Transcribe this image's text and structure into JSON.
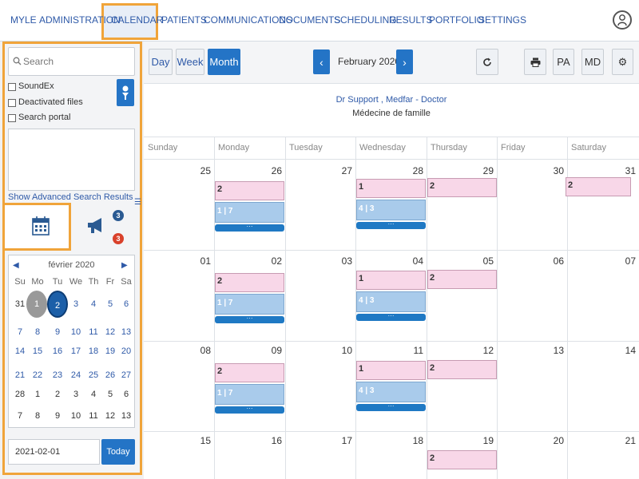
{
  "nav": {
    "items": [
      "MYLE",
      "ADMINISTRATION",
      "CALENDAR",
      "PATIENTS",
      "COMMUNICATIONS",
      "DOCUMENTS",
      "SCHEDULING",
      "RESULTS",
      "PORTFOLIO",
      "SETTINGS"
    ],
    "active": "CALENDAR"
  },
  "sidebar": {
    "search_placeholder": "Search",
    "options": [
      "SoundEx",
      "Deactivated files",
      "Search portal"
    ],
    "show_advanced": "Show Advanced Search Results",
    "badges": {
      "messages": "3",
      "alerts": "3"
    },
    "minical": {
      "title": "février 2020",
      "weekdays": [
        "Su",
        "Mo",
        "Tu",
        "We",
        "Th",
        "Fr",
        "Sa"
      ],
      "weeks": [
        [
          "31",
          "1",
          "2",
          "3",
          "4",
          "5",
          "6"
        ],
        [
          "7",
          "8",
          "9",
          "10",
          "11",
          "12",
          "13"
        ],
        [
          "14",
          "15",
          "16",
          "17",
          "18",
          "19",
          "20"
        ],
        [
          "21",
          "22",
          "23",
          "24",
          "25",
          "26",
          "27"
        ],
        [
          "28",
          "1",
          "2",
          "3",
          "4",
          "5",
          "6"
        ],
        [
          "7",
          "8",
          "9",
          "10",
          "11",
          "12",
          "13"
        ]
      ],
      "selected": "2",
      "highlighted": "1"
    },
    "date_value": "2021-02-01",
    "today_label": "Today"
  },
  "toolbar": {
    "views": [
      "Day",
      "Week",
      "Month"
    ],
    "active_view": "Month",
    "month_label": "February 2020",
    "pa_label": "PA",
    "md_label": "MD"
  },
  "provider": {
    "name": "Dr Support , Medfar - Doctor",
    "specialty": "Médecine de famille"
  },
  "calendar": {
    "weekdays": [
      "Sunday",
      "Monday",
      "Tuesday",
      "Wednesday",
      "Thursday",
      "Friday",
      "Saturday"
    ],
    "weeks": [
      [
        "25",
        "26",
        "27",
        "28",
        "29",
        "30",
        "31"
      ],
      [
        "01",
        "02",
        "03",
        "04",
        "05",
        "06",
        "07"
      ],
      [
        "08",
        "09",
        "10",
        "11",
        "12",
        "13",
        "14"
      ],
      [
        "15",
        "16",
        "17",
        "18",
        "19",
        "20",
        "21"
      ]
    ],
    "events": {
      "monday_pink": "2",
      "monday_blue_a": "1",
      "monday_blue_b": "7",
      "wednesday_pink": "1",
      "wednesday_blue_a": "4",
      "wednesday_blue_b": "3",
      "thursday_pink": "2",
      "saturday_pink": "2",
      "more": "···"
    }
  },
  "colors": {
    "accent": "#2474c6",
    "highlight": "#f0a43a",
    "event_pink": "#f8d7e8",
    "event_blue": "#a9cbeb"
  }
}
